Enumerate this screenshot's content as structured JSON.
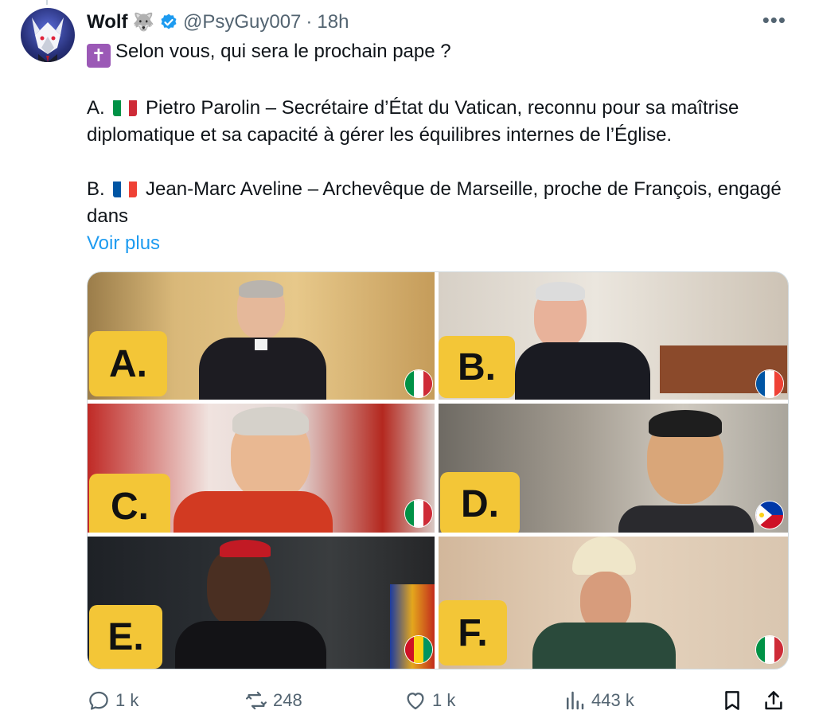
{
  "post": {
    "author_name": "Wolf",
    "author_emoji": "🐺",
    "handle": "@PsyGuy007",
    "separator": "·",
    "time": "18h",
    "line1": "Selon vous, qui sera le prochain pape ?",
    "optA_prefix": "A.",
    "optA_text": "Pietro Parolin – Secrétaire d’État du Vatican, reconnu pour sa maîtrise diplomatique et sa capacité à gérer les équilibres internes de l’Église.",
    "optB_prefix": "B.",
    "optB_text": "Jean-Marc Aveline – Archevêque de Marseille, proche de François, engagé dans",
    "see_more": "Voir plus",
    "more_menu": "•••"
  },
  "grid_labels": [
    "A.",
    "B.",
    "C.",
    "D.",
    "E.",
    "F."
  ],
  "actions": {
    "replies": "1 k",
    "reposts": "248",
    "likes": "1 k",
    "views": "443 k"
  },
  "colors": {
    "accent": "#1d9bf0",
    "tag": "#f3c637",
    "text_secondary": "#536471"
  }
}
